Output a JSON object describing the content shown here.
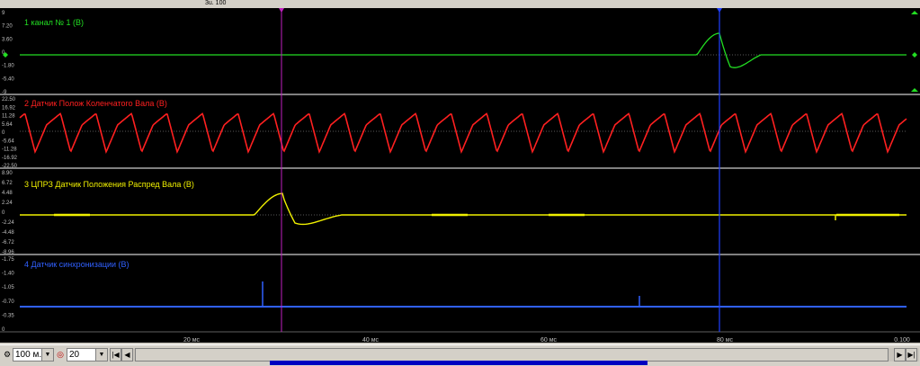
{
  "toolbar": {
    "partial_text": "3u. 100"
  },
  "channels": [
    {
      "label": "1 канал № 1 (В)",
      "color": "#22dd22",
      "ticks": [
        "9",
        "7.20",
        "3.60",
        "0",
        "-1.80",
        "-5.40",
        "-9"
      ]
    },
    {
      "label": "2 Датчик Полож Коленчатого Вала (В)",
      "color": "#ff2020",
      "ticks": [
        "22.50",
        "16.92",
        "11.28",
        "5.64",
        "0",
        "-5.64",
        "-11.28",
        "-16.92",
        "-22.50"
      ]
    },
    {
      "label": "3 ЦПРЗ Датчик Положения Распред Вала (В)",
      "color": "#f0f000",
      "ticks": [
        "8.90",
        "6.72",
        "4.48",
        "2.24",
        "0",
        "-2.24",
        "-4.48",
        "-6.72",
        "-8.96"
      ]
    },
    {
      "label": "4 Датчик синхронизации (В)",
      "color": "#3060ff",
      "ticks": [
        "-1.75",
        "-1.40",
        "-1.05",
        "-0.70",
        "-0.35",
        "0"
      ]
    }
  ],
  "time_axis": {
    "labels": [
      "20 мс",
      "40 мс",
      "60 мс",
      "80 мс",
      "0.100"
    ]
  },
  "cursors": {
    "left_color": "#c020c0",
    "right_color": "#2040ff"
  },
  "status": {
    "zoom_value": "100 м...",
    "count_value": "20"
  },
  "colors": {
    "background": "#000000",
    "separator": "#ffffff",
    "dotted_zero": "#ffffff"
  }
}
